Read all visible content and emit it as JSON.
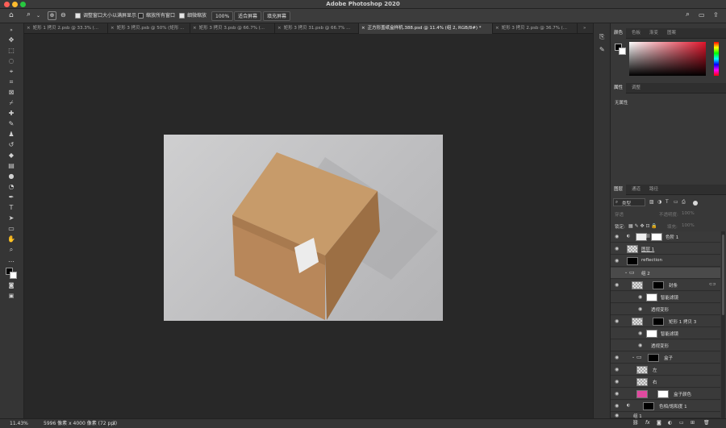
{
  "app": {
    "title": "Adobe Photoshop 2020"
  },
  "options_bar": {
    "resize_windows_label": "调整窗口大小以满屏显示",
    "zoom_all_label": "缩放所有窗口",
    "scrubby_zoom_label": "细微缩放",
    "zoom_100": "100%",
    "fit_screen": "适合屏幕",
    "fill_screen": "填充屏幕"
  },
  "tabs": [
    {
      "label": "矩形 1 拷贝 2.psb @ 33.3% (..."
    },
    {
      "label": "矩形 3 拷贝.psb @ 50% (矩形 ..."
    },
    {
      "label": "矩形 3 拷贝 3.psb @ 66.7% (..."
    },
    {
      "label": "矩形 3 拷贝 31.psb @ 66.7% ..."
    },
    {
      "label": "正方形盖纸盒样机.388.psd @ 11.4% (组 2, RGB/8#) *"
    },
    {
      "label": "矩形 3 拷贝 2.psb @ 36.7% (..."
    }
  ],
  "status": {
    "zoom": "11.43%",
    "doc_size": "5996 像素 x 4000 像素 (72 ppi)",
    "arrow": ")"
  },
  "color_panel": {
    "tabs": [
      "颜色",
      "色板",
      "渐变",
      "图案"
    ]
  },
  "properties_panel": {
    "tabs": [
      "属性",
      "调整"
    ],
    "no_properties": "无属性"
  },
  "layers_panel": {
    "tabs": [
      "图层",
      "通道",
      "路径"
    ],
    "filter_label": "类型",
    "blend_mode": "穿透",
    "opacity_label": "不透明度:",
    "opacity_value": "100%",
    "lock_label": "锁定:",
    "fill_label": "填充:",
    "fill_value": "100%",
    "layers": [
      {
        "name": "色阶 1"
      },
      {
        "name": "图层 1"
      },
      {
        "name": "reflection"
      },
      {
        "name": "组 2"
      },
      {
        "name": "封条"
      },
      {
        "name": "智能滤镜"
      },
      {
        "name": "透视变形"
      },
      {
        "name": "矩形 1 拷贝 3"
      },
      {
        "name": "智能滤镜"
      },
      {
        "name": "透视变形"
      },
      {
        "name": "盒子"
      },
      {
        "name": "左"
      },
      {
        "name": "右"
      },
      {
        "name": "盒子颜色"
      },
      {
        "name": "色相/饱和度 1"
      },
      {
        "name": "组 1"
      }
    ],
    "bottom_fx": "fx"
  },
  "colors": {
    "accent": "#2f6bd6",
    "traffic_red": "#ff5f57",
    "traffic_yellow": "#febc2e",
    "traffic_green": "#28c840",
    "box_top": "#c79b6a",
    "box_side": "#a8794d",
    "swatch_pink": "#e04aa0"
  }
}
